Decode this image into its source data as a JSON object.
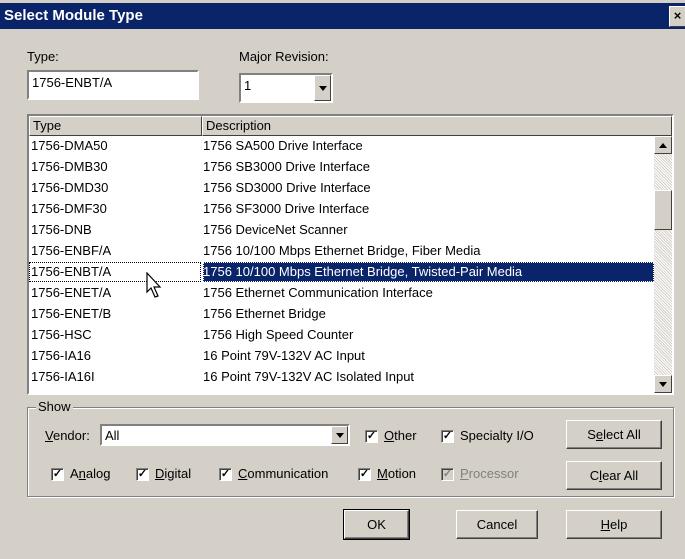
{
  "window": {
    "title": "Select Module Type",
    "close_glyph": "×"
  },
  "type_label": "Type:",
  "type_value": "1756-ENBT/A",
  "major_revision_label": "Major Revision:",
  "major_revision_value": "1",
  "list": {
    "headers": [
      "Type",
      "Description"
    ],
    "rows": [
      {
        "type": "1756-DMA50",
        "description": "1756 SA500 Drive Interface"
      },
      {
        "type": "1756-DMB30",
        "description": "1756 SB3000 Drive Interface"
      },
      {
        "type": "1756-DMD30",
        "description": "1756 SD3000 Drive Interface"
      },
      {
        "type": "1756-DMF30",
        "description": "1756 SF3000 Drive Interface"
      },
      {
        "type": "1756-DNB",
        "description": "1756 DeviceNet Scanner"
      },
      {
        "type": "1756-ENBF/A",
        "description": "1756 10/100 Mbps Ethernet Bridge, Fiber Media"
      },
      {
        "type": "1756-ENBT/A",
        "description": "1756 10/100 Mbps Ethernet Bridge, Twisted-Pair Media",
        "selected": true
      },
      {
        "type": "1756-ENET/A",
        "description": "1756 Ethernet Communication Interface"
      },
      {
        "type": "1756-ENET/B",
        "description": "1756 Ethernet Bridge"
      },
      {
        "type": "1756-HSC",
        "description": "1756 High Speed Counter"
      },
      {
        "type": "1756-IA16",
        "description": "16 Point 79V-132V AC Input"
      },
      {
        "type": "1756-IA16I",
        "description": "16 Point 79V-132V AC Isolated Input"
      }
    ]
  },
  "show": {
    "label": "Show",
    "vendor_label": "Vendor:",
    "vendor_value": "All",
    "check_mark": "✓",
    "checkboxes": [
      {
        "label": "Other",
        "checked": true
      },
      {
        "label": "Specialty I/O",
        "checked": true
      },
      {
        "label": "Analog",
        "checked": true
      },
      {
        "label": "Digital",
        "checked": true
      },
      {
        "label": "Communication",
        "checked": true
      },
      {
        "label": "Motion",
        "checked": true
      },
      {
        "label": "Processor",
        "checked": true,
        "disabled": true
      }
    ],
    "select_all": "Select All",
    "clear_all": "Clear All"
  },
  "buttons": {
    "ok": "OK",
    "cancel": "Cancel",
    "help": "Help"
  },
  "colors": {
    "titlebar": "#0a246a",
    "face": "#d4d0c8",
    "selection": "#0a246a"
  },
  "icons": [
    "close-icon",
    "dropdown-arrow-icon",
    "scroll-up-icon",
    "scroll-down-icon",
    "mouse-pointer-icon",
    "check-icon"
  ]
}
